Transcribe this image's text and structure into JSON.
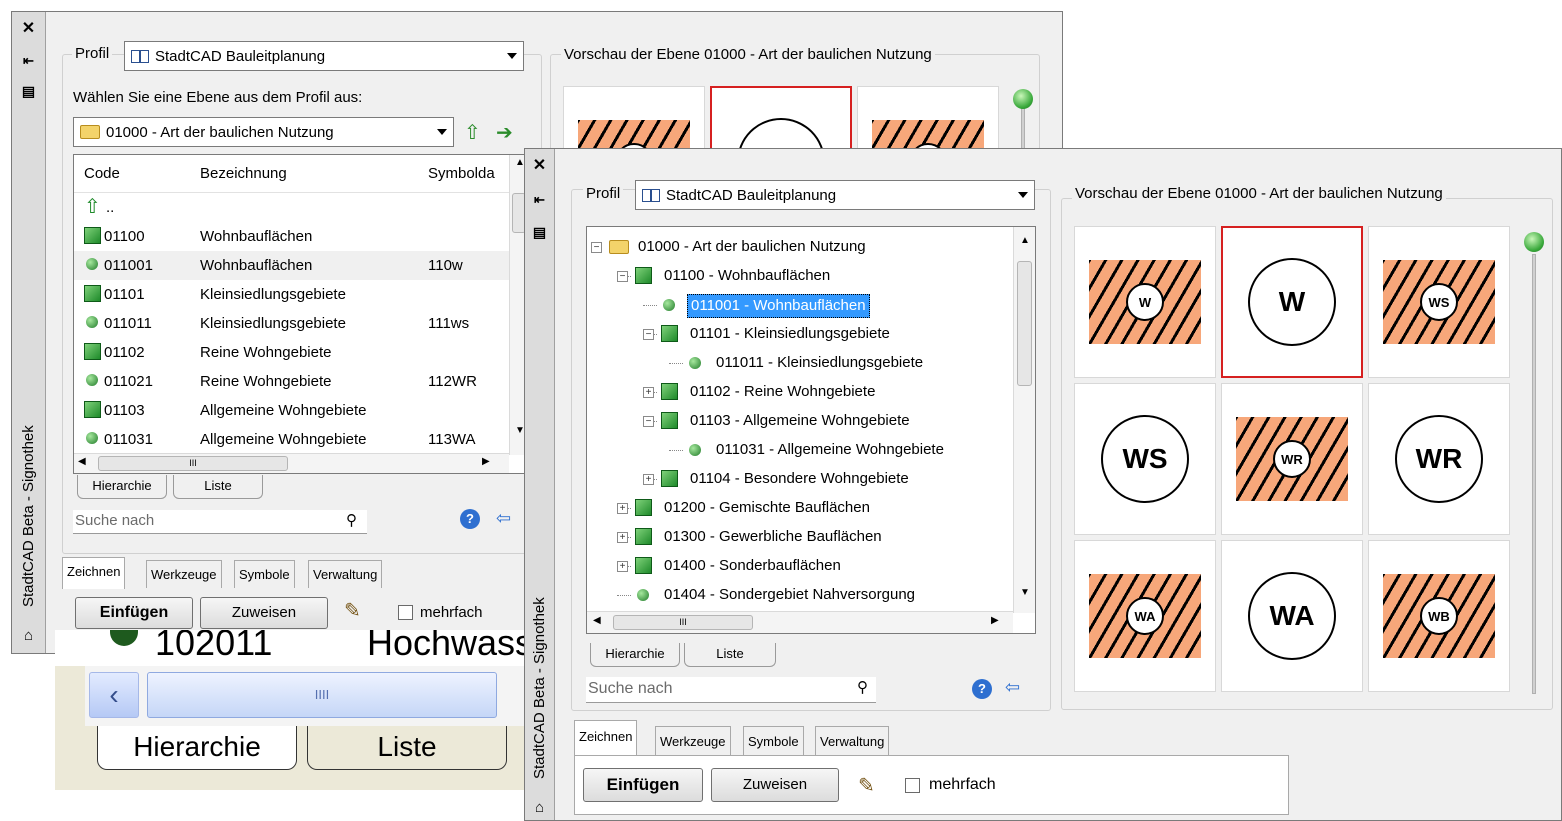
{
  "back_panel": {
    "vertical_title": "StadtCAD Beta - Signothek",
    "profile_label": "Profil",
    "profile_value": "StadtCAD Bauleitplanung",
    "preview_title": "Vorschau der Ebene 01000 - Art der baulichen Nutzung",
    "choose_label": "Wählen Sie eine Ebene aus dem Profil aus:",
    "layer_value": "01000 - Art der baulichen Nutzung",
    "columns": [
      "Code",
      "Bezeichnung",
      "Symbolda"
    ],
    "up_row": "..",
    "rows": [
      {
        "code": "01100",
        "name": "Wohnbauflächen",
        "symbol": "",
        "icon": "square-icon"
      },
      {
        "code": "011001",
        "name": "Wohnbauflächen",
        "symbol": "110w",
        "icon": "dot-icon"
      },
      {
        "code": "01101",
        "name": "Kleinsiedlungsgebiete",
        "symbol": "",
        "icon": "square-icon"
      },
      {
        "code": "011011",
        "name": "Kleinsiedlungsgebiete",
        "symbol": "111ws",
        "icon": "dot-icon"
      },
      {
        "code": "01102",
        "name": "Reine Wohngebiete",
        "symbol": "",
        "icon": "square-icon"
      },
      {
        "code": "011021",
        "name": "Reine Wohngebiete",
        "symbol": "112WR",
        "icon": "dot-icon"
      },
      {
        "code": "01103",
        "name": "Allgemeine Wohngebiete",
        "symbol": "",
        "icon": "square-icon"
      },
      {
        "code": "011031",
        "name": "Allgemeine Wohngebiete",
        "symbol": "113WA",
        "icon": "dot-icon"
      }
    ],
    "hscroll_grip": "III",
    "view_tabs": [
      "Hierarchie",
      "Liste"
    ],
    "search_placeholder": "Suche nach",
    "tool_tabs": [
      "Zeichnen",
      "Werkzeuge",
      "Symbole",
      "Verwaltung"
    ],
    "insert_label": "Einfügen",
    "assign_label": "Zuweisen",
    "multiple_label": "mehrfach"
  },
  "zoom_inset": {
    "row_code": "102011",
    "row_name": "Hochwasse",
    "grip": "IIII",
    "tabs": [
      "Hierarchie",
      "Liste"
    ]
  },
  "front_panel": {
    "vertical_title": "StadtCAD Beta - Signothek",
    "profile_label": "Profil",
    "profile_value": "StadtCAD Bauleitplanung",
    "preview_title": "Vorschau der Ebene 01000 - Art der baulichen Nutzung",
    "tree": [
      {
        "label": "01000 - Art der baulichen Nutzung",
        "icon": "folder-icon",
        "level": 0,
        "pm": "-"
      },
      {
        "label": "01100 - Wohnbauflächen",
        "icon": "square-icon",
        "level": 1,
        "pm": "-"
      },
      {
        "label": "011001 - Wohnbauflächen",
        "icon": "dot-icon",
        "level": 2,
        "pm": "",
        "selected": true
      },
      {
        "label": "01101 - Kleinsiedlungsgebiete",
        "icon": "square-icon",
        "level": 2,
        "pm": "-"
      },
      {
        "label": "011011 - Kleinsiedlungsgebiete",
        "icon": "dot-icon",
        "level": 3,
        "pm": ""
      },
      {
        "label": "01102 - Reine Wohngebiete",
        "icon": "square-icon",
        "level": 2,
        "pm": "+"
      },
      {
        "label": "01103 - Allgemeine Wohngebiete",
        "icon": "square-icon",
        "level": 2,
        "pm": "-"
      },
      {
        "label": "011031 - Allgemeine Wohngebiete",
        "icon": "dot-icon",
        "level": 3,
        "pm": ""
      },
      {
        "label": "01104 - Besondere Wohngebiete",
        "icon": "square-icon",
        "level": 2,
        "pm": "+"
      },
      {
        "label": "01200 - Gemischte Bauflächen",
        "icon": "square-icon",
        "level": 1,
        "pm": "+"
      },
      {
        "label": "01300 - Gewerbliche Bauflächen",
        "icon": "square-icon",
        "level": 1,
        "pm": "+"
      },
      {
        "label": "01400 - Sonderbauflächen",
        "icon": "square-icon",
        "level": 1,
        "pm": "+"
      },
      {
        "label": "01404 - Sondergebiet Nahversorgung",
        "icon": "dot-icon",
        "level": 1,
        "pm": ""
      }
    ],
    "hscroll_grip": "III",
    "view_tabs": [
      "Hierarchie",
      "Liste"
    ],
    "search_placeholder": "Suche nach",
    "tool_tabs": [
      "Zeichnen",
      "Werkzeuge",
      "Symbole",
      "Verwaltung"
    ],
    "insert_label": "Einfügen",
    "assign_label": "Zuweisen",
    "multiple_label": "mehrfach",
    "symbols": [
      {
        "text": "W",
        "style": "hatched"
      },
      {
        "text": "W",
        "style": "plain",
        "selected": true
      },
      {
        "text": "WS",
        "style": "hatched"
      },
      {
        "text": "WS",
        "style": "plain"
      },
      {
        "text": "WR",
        "style": "hatched"
      },
      {
        "text": "WR",
        "style": "plain"
      },
      {
        "text": "WA",
        "style": "hatched"
      },
      {
        "text": "WA",
        "style": "plain"
      },
      {
        "text": "WB",
        "style": "hatched"
      }
    ],
    "back_symbols_visible": [
      {
        "text": "",
        "style": "hatched"
      },
      {
        "text": "",
        "style": "plain",
        "selected": true
      },
      {
        "text": "",
        "style": "hatched"
      }
    ]
  },
  "colors": {
    "hatch_fill": "#f7a77a",
    "selection_blue": "#3399ff",
    "selected_border": "#d62020",
    "node_green": "#1e8a2a"
  }
}
